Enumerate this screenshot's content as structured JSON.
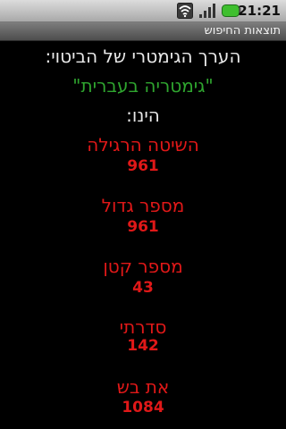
{
  "status_bar": {
    "time": "21:21",
    "icons": [
      "wifi-icon",
      "signal-icon",
      "battery-icon"
    ],
    "battery_color": "#3fbf2f"
  },
  "title_bar": {
    "title": "תוצאות החיפוש"
  },
  "result": {
    "heading": "הערך הגימטרי של הביטוי:",
    "phrase": "\"גימטריה בעברית\"",
    "equals": "הינו:",
    "methods": [
      {
        "name": "השיטה הרגילה",
        "value": "961"
      },
      {
        "name": "מספר גדול",
        "value": "961"
      },
      {
        "name": "מספר קטן",
        "value": "43"
      },
      {
        "name": "סדרתי",
        "value": "142"
      },
      {
        "name": "את בש",
        "value": "1084"
      }
    ]
  },
  "colors": {
    "heading": "#e8e8e8",
    "phrase": "#2fa52f",
    "method": "#e01818",
    "background": "#000000"
  }
}
